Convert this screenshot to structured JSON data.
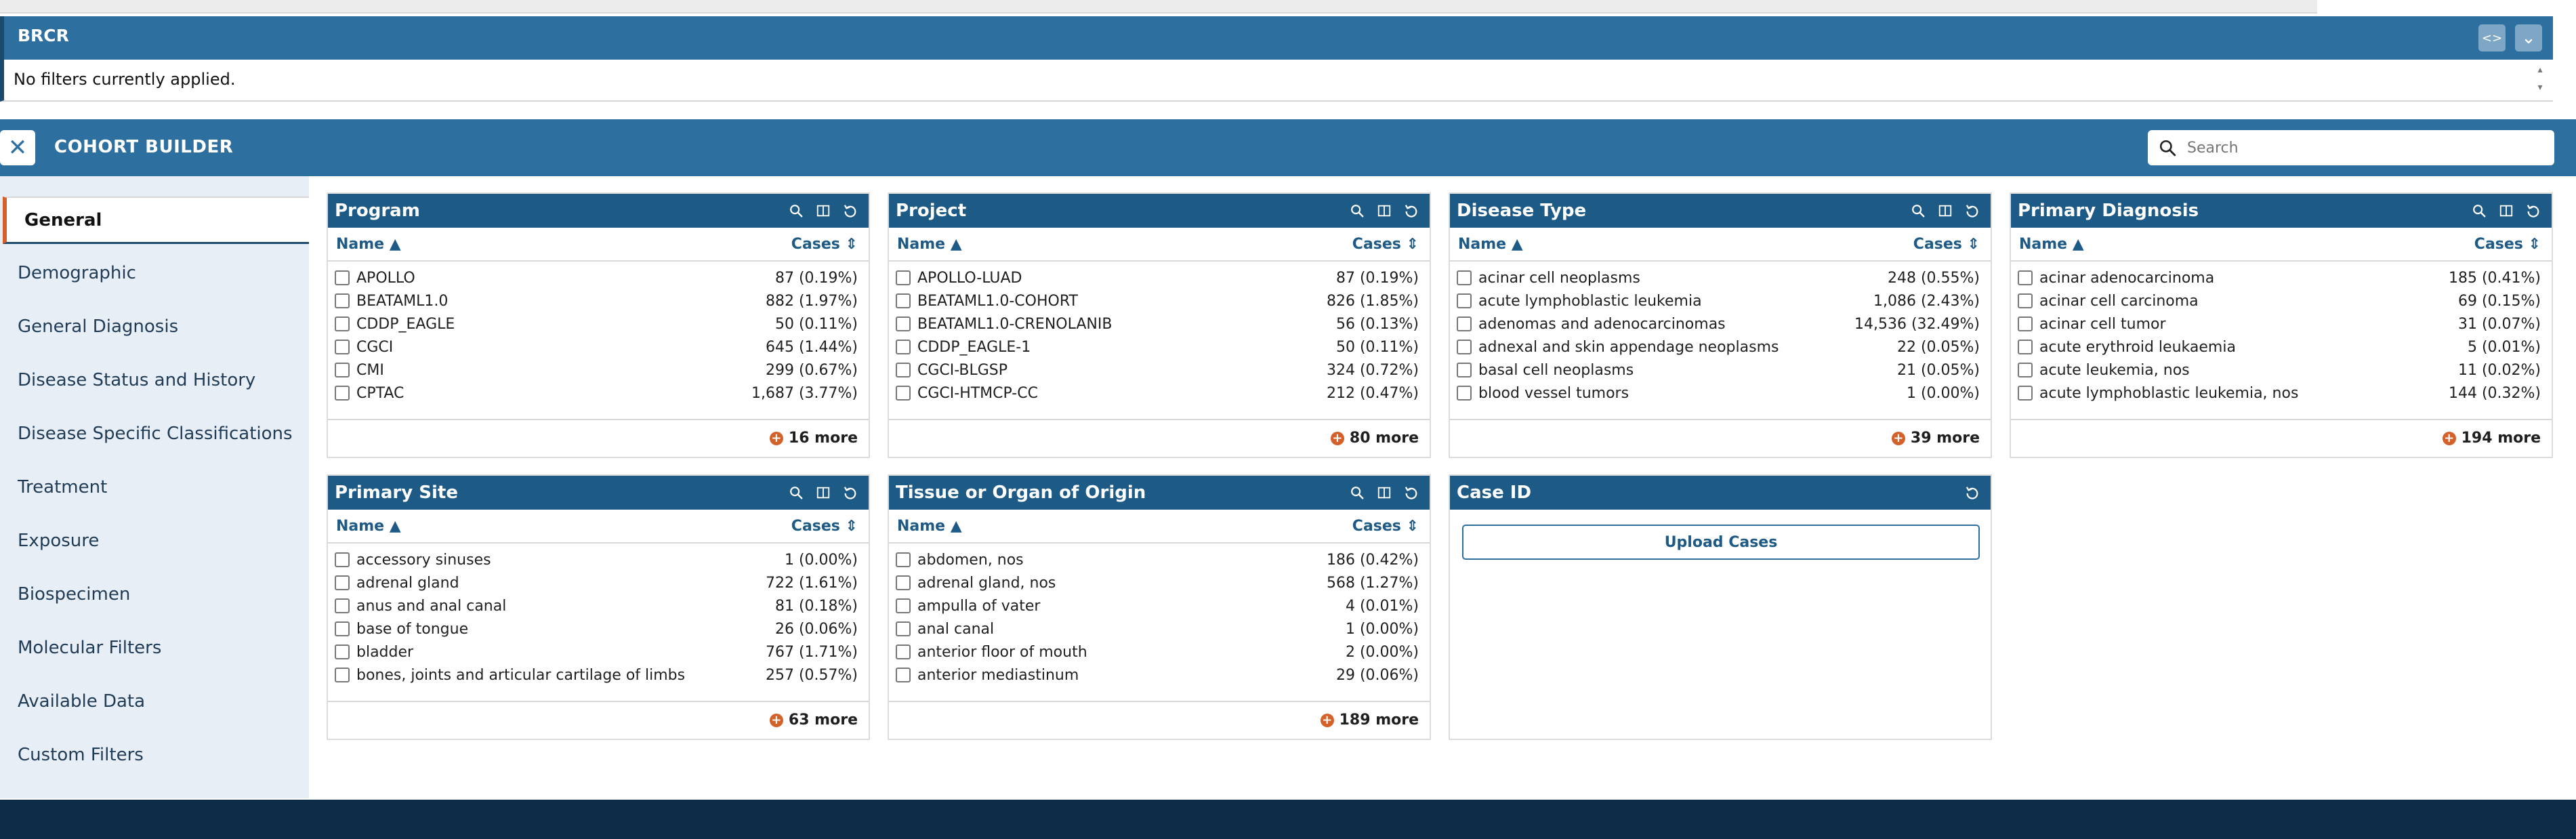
{
  "brcr": {
    "title": "BRCR",
    "filter_text": "No filters currently applied.",
    "code_btn": "<>",
    "expand_btn": "⌄"
  },
  "cohort_builder": {
    "title": "COHORT BUILDER",
    "close_label": "✕",
    "search_placeholder": "Search"
  },
  "sidebar": {
    "items": [
      {
        "label": "General"
      },
      {
        "label": "Demographic"
      },
      {
        "label": "General Diagnosis"
      },
      {
        "label": "Disease Status and History"
      },
      {
        "label": "Disease Specific Classifications"
      },
      {
        "label": "Treatment"
      },
      {
        "label": "Exposure"
      },
      {
        "label": "Biospecimen"
      },
      {
        "label": "Molecular Filters"
      },
      {
        "label": "Available Data"
      },
      {
        "label": "Custom Filters"
      }
    ]
  },
  "columns": {
    "name": "Name ▲",
    "cases": "Cases ⇕"
  },
  "cards": {
    "program": {
      "title": "Program",
      "rows": [
        {
          "label": "APOLLO",
          "count": "87 (0.19%)"
        },
        {
          "label": "BEATAML1.0",
          "count": "882 (1.97%)"
        },
        {
          "label": "CDDP_EAGLE",
          "count": "50 (0.11%)"
        },
        {
          "label": "CGCI",
          "count": "645 (1.44%)"
        },
        {
          "label": "CMI",
          "count": "299 (0.67%)"
        },
        {
          "label": "CPTAC",
          "count": "1,687 (3.77%)"
        }
      ],
      "more": "16 more"
    },
    "project": {
      "title": "Project",
      "rows": [
        {
          "label": "APOLLO-LUAD",
          "count": "87 (0.19%)"
        },
        {
          "label": "BEATAML1.0-COHORT",
          "count": "826 (1.85%)"
        },
        {
          "label": "BEATAML1.0-CRENOLANIB",
          "count": "56 (0.13%)"
        },
        {
          "label": "CDDP_EAGLE-1",
          "count": "50 (0.11%)"
        },
        {
          "label": "CGCI-BLGSP",
          "count": "324 (0.72%)"
        },
        {
          "label": "CGCI-HTMCP-CC",
          "count": "212 (0.47%)"
        }
      ],
      "more": "80 more"
    },
    "disease_type": {
      "title": "Disease Type",
      "rows": [
        {
          "label": "acinar cell neoplasms",
          "count": "248 (0.55%)"
        },
        {
          "label": "acute lymphoblastic leukemia",
          "count": "1,086 (2.43%)"
        },
        {
          "label": "adenomas and adenocarcinomas",
          "count": "14,536 (32.49%)"
        },
        {
          "label": "adnexal and skin appendage neoplasms",
          "count": "22 (0.05%)"
        },
        {
          "label": "basal cell neoplasms",
          "count": "21 (0.05%)"
        },
        {
          "label": "blood vessel tumors",
          "count": "1 (0.00%)"
        }
      ],
      "more": "39 more"
    },
    "primary_diagnosis": {
      "title": "Primary Diagnosis",
      "rows": [
        {
          "label": "acinar adenocarcinoma",
          "count": "185 (0.41%)"
        },
        {
          "label": "acinar cell carcinoma",
          "count": "69 (0.15%)"
        },
        {
          "label": "acinar cell tumor",
          "count": "31 (0.07%)"
        },
        {
          "label": "acute erythroid leukaemia",
          "count": "5 (0.01%)"
        },
        {
          "label": "acute leukemia, nos",
          "count": "11 (0.02%)"
        },
        {
          "label": "acute lymphoblastic leukemia, nos",
          "count": "144 (0.32%)"
        }
      ],
      "more": "194 more"
    },
    "primary_site": {
      "title": "Primary Site",
      "rows": [
        {
          "label": "accessory sinuses",
          "count": "1 (0.00%)"
        },
        {
          "label": "adrenal gland",
          "count": "722 (1.61%)"
        },
        {
          "label": "anus and anal canal",
          "count": "81 (0.18%)"
        },
        {
          "label": "base of tongue",
          "count": "26 (0.06%)"
        },
        {
          "label": "bladder",
          "count": "767 (1.71%)"
        },
        {
          "label": "bones, joints and articular cartilage of limbs",
          "count": "257 (0.57%)"
        }
      ],
      "more": "63 more"
    },
    "tissue_origin": {
      "title": "Tissue or Organ of Origin",
      "rows": [
        {
          "label": "abdomen, nos",
          "count": "186 (0.42%)"
        },
        {
          "label": "adrenal gland, nos",
          "count": "568 (1.27%)"
        },
        {
          "label": "ampulla of vater",
          "count": "4 (0.01%)"
        },
        {
          "label": "anal canal",
          "count": "1 (0.00%)"
        },
        {
          "label": "anterior floor of mouth",
          "count": "2 (0.00%)"
        },
        {
          "label": "anterior mediastinum",
          "count": "29 (0.06%)"
        }
      ],
      "more": "189 more"
    },
    "case_id": {
      "title": "Case ID",
      "upload_label": "Upload Cases"
    }
  },
  "colors": {
    "header_blue": "#2d6f9f",
    "card_header_blue": "#1e5a86",
    "accent_orange": "#d4602a",
    "sidebar_bg": "#e8eef6",
    "footer_navy": "#0c2c48"
  }
}
